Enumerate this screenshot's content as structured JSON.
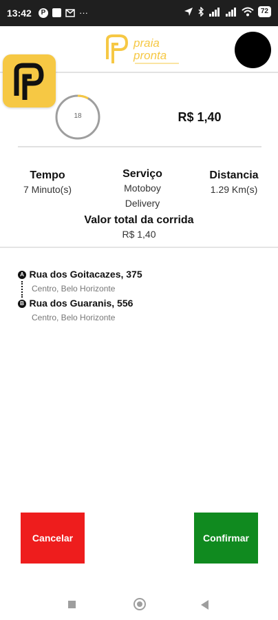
{
  "status_bar": {
    "time": "13:42",
    "battery": "72"
  },
  "header": {
    "logo_line1": "praia",
    "logo_line2": "pronta"
  },
  "trip": {
    "timer_value": "18",
    "timer_progress": 0.08,
    "price": "R$ 1,40",
    "time_label": "Tempo",
    "time_value": "7 Minuto(s)",
    "service_label": "Serviço",
    "service_value_line1": "Motoboy",
    "service_value_line2": "Delivery",
    "distance_label": "Distancia",
    "distance_value": "1.29 Km(s)",
    "total_label": "Valor total da corrida",
    "total_value": "R$ 1,40"
  },
  "route": {
    "origin_marker": "A",
    "origin_address": "Rua dos Goitacazes, 375",
    "origin_sub": "Centro, Belo Horizonte",
    "destination_marker": "B",
    "destination_address": "Rua dos Guaranis, 556",
    "destination_sub": "Centro, Belo Horizonte"
  },
  "actions": {
    "cancel_label": "Cancelar",
    "confirm_label": "Confirmar"
  },
  "colors": {
    "brand_yellow": "#f6c844",
    "cancel_red": "#ee1d1d",
    "confirm_green": "#108a1f"
  }
}
